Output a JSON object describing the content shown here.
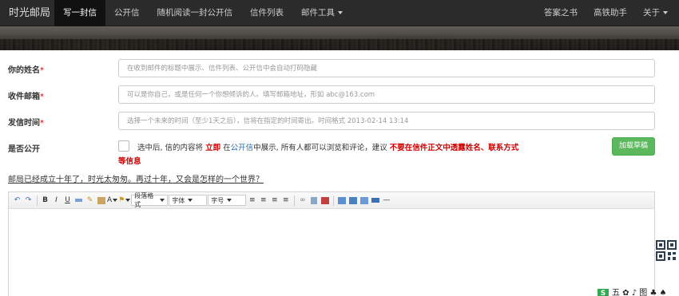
{
  "navbar": {
    "brand": "时光邮局",
    "items": [
      {
        "label": "写一封信",
        "active": true
      },
      {
        "label": "公开信"
      },
      {
        "label": "随机阅读一封公开信"
      },
      {
        "label": "信件列表"
      },
      {
        "label": "邮件工具",
        "dropdown": true
      }
    ],
    "right": [
      {
        "label": "答案之书"
      },
      {
        "label": "高铁助手"
      },
      {
        "label": "关于",
        "dropdown": true
      }
    ]
  },
  "form": {
    "name_label": "你的姓名",
    "name_placeholder": "在收到邮件的标题中展示、信件列表、公开信中会自动打码隐藏",
    "email_label": "收件邮箱",
    "email_placeholder": "可以是你自己，或是任何一个你想倾诉的人。填写邮箱地址，形如 abc@163.com",
    "time_label": "发信时间",
    "time_placeholder": "选择一个未来的时间（至少1天之后），信将在指定的时间寄出。时间格式 2013-02-14 13:14",
    "required_mark": "*",
    "public_label": "是否公开",
    "public_text_1": "选中后, 信的内容将",
    "public_text_immediate": "立即",
    "public_text_2": "在",
    "public_text_link": "公开信",
    "public_text_3": "中展示, 所有人都可以浏览和评论，建议",
    "public_text_warning": "不要在信件正文中透露姓名、联系方式",
    "public_text_warning_2": "等信息",
    "draft_button": "加载草稿",
    "slogan": "邮局已经成立十年了，时光太匆匆。再过十年，又会是怎样的一个世界？"
  },
  "editor": {
    "toolbar": {
      "undo_icon": "undo-icon",
      "redo_icon": "redo-icon",
      "bold": "B",
      "italic": "I",
      "underline": "U",
      "font_color": "A",
      "paragraph_format": "段落格式",
      "font_family": "字体",
      "font_size": "字号",
      "hr": "—"
    }
  },
  "floating": {
    "brand_letter": "S",
    "brand_text": "五 ✿ ♪ 图 ♣ ♠"
  },
  "colors": {
    "navbar_bg": "#2b2b2b",
    "active_nav": "#111111",
    "required": "#cc0000",
    "link": "#2a6fb5",
    "draft_button": "#5cb85c"
  }
}
